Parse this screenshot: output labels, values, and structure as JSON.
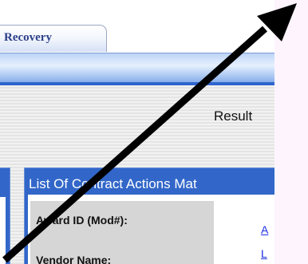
{
  "tabs": {
    "recovery_label": "Recovery"
  },
  "result_label": "Result",
  "results_panel": {
    "header": "List Of Contract Actions Mat",
    "fields": [
      {
        "label": "Award ID (Mod#):",
        "value": "A"
      },
      {
        "label": "Vendor Name:",
        "value": "L"
      }
    ]
  },
  "colors": {
    "tab_text": "#2b3f8a",
    "panel_blue": "#3267c9",
    "band_blue": "#2f64cd",
    "link_blue": "#1a2ee0",
    "right_margin": "#fdf4fd"
  },
  "overlay": {
    "icon": "arrow-icon"
  }
}
